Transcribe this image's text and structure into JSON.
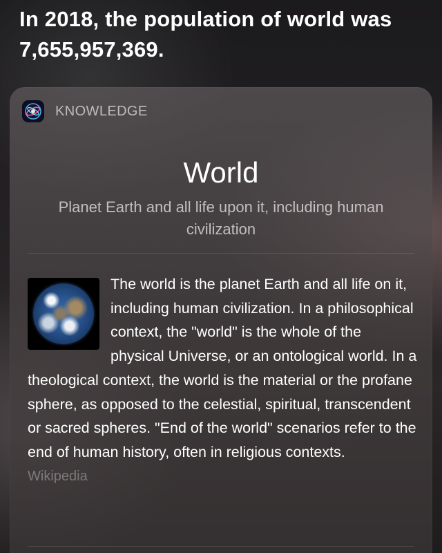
{
  "siri": {
    "answer": "In 2018, the population of world was 7,655,957,369."
  },
  "card": {
    "header_label": "KNOWLEDGE",
    "header_icon": "siri-icon",
    "title": "World",
    "subtitle": "Planet Earth and all life upon it, including human civilization",
    "thumbnail_icon": "earth-icon",
    "body": "The world is the planet Earth and all life on it, including human civilization. In a philosophical context, the \"world\" is the whole of the physical Universe, or an ontological world. In a theological context, the world is the material or the profane sphere, as opposed to the celestial, spiritual, transcendent or sacred spheres. \"End of the world\" scenarios refer to the end of human history, often in religious contexts.",
    "source": "Wikipedia"
  }
}
